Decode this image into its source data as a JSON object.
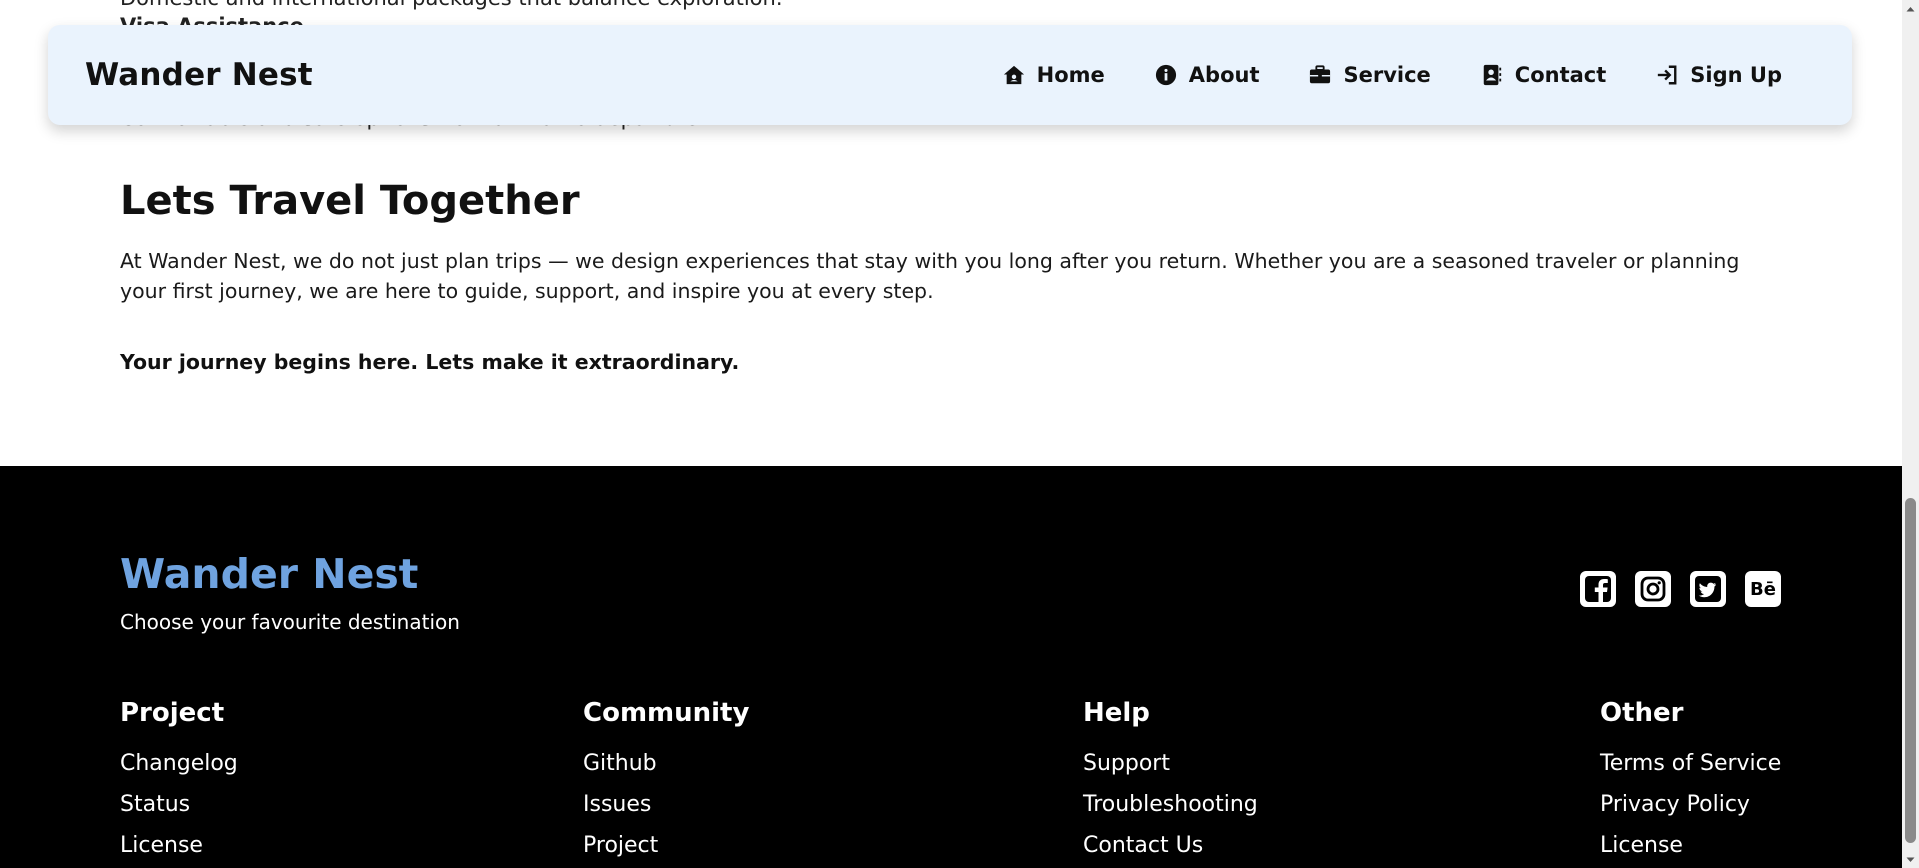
{
  "scrolled": {
    "line1": "Domestic and international packages that balance exploration.",
    "line2": "Visa Assistance",
    "line3": "Comfortable and safe options from arrival to departure."
  },
  "navbar": {
    "brand": "Wander Nest",
    "links": [
      {
        "label": "Home",
        "icon": "home-icon"
      },
      {
        "label": "About",
        "icon": "info-icon"
      },
      {
        "label": "Service",
        "icon": "briefcase-icon"
      },
      {
        "label": "Contact",
        "icon": "address-book-icon"
      },
      {
        "label": "Sign Up",
        "icon": "sign-in-icon"
      }
    ]
  },
  "main": {
    "heading": "Lets Travel Together",
    "paragraph": "At Wander Nest, we do not just plan trips — we design experiences that stay with you long after you return. Whether you are a seasoned traveler or planning your first journey, we are here to guide, support, and inspire you at every step.",
    "tagline": "Your journey begins here. Lets make it extraordinary."
  },
  "footer": {
    "brand": "Wander Nest",
    "subtitle": "Choose your favourite destination",
    "brand_color": "#6fa3e0",
    "socials": [
      "facebook-icon",
      "instagram-icon",
      "twitter-icon",
      "behance-icon"
    ],
    "behance_text": "Bē",
    "columns": [
      {
        "title": "Project",
        "links": [
          "Changelog",
          "Status",
          "License"
        ]
      },
      {
        "title": "Community",
        "links": [
          "Github",
          "Issues",
          "Project"
        ]
      },
      {
        "title": "Help",
        "links": [
          "Support",
          "Troubleshooting",
          "Contact Us"
        ]
      },
      {
        "title": "Other",
        "links": [
          "Terms of Service",
          "Privacy Policy",
          "License"
        ]
      }
    ]
  }
}
